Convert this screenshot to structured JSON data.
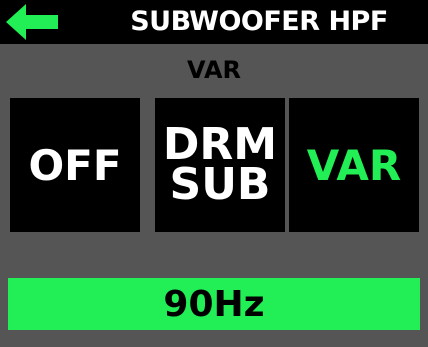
{
  "header": {
    "title": "SUBWOOFER HPF",
    "back_icon": "left-arrow-icon"
  },
  "mode_label": "VAR",
  "options": [
    {
      "label": "OFF",
      "selected": false
    },
    {
      "label": "DRM\nSUB",
      "selected": false
    },
    {
      "label": "VAR",
      "selected": true
    }
  ],
  "value": "90Hz",
  "colors": {
    "accent": "#22ee55",
    "background": "#555555",
    "button": "#000000"
  }
}
